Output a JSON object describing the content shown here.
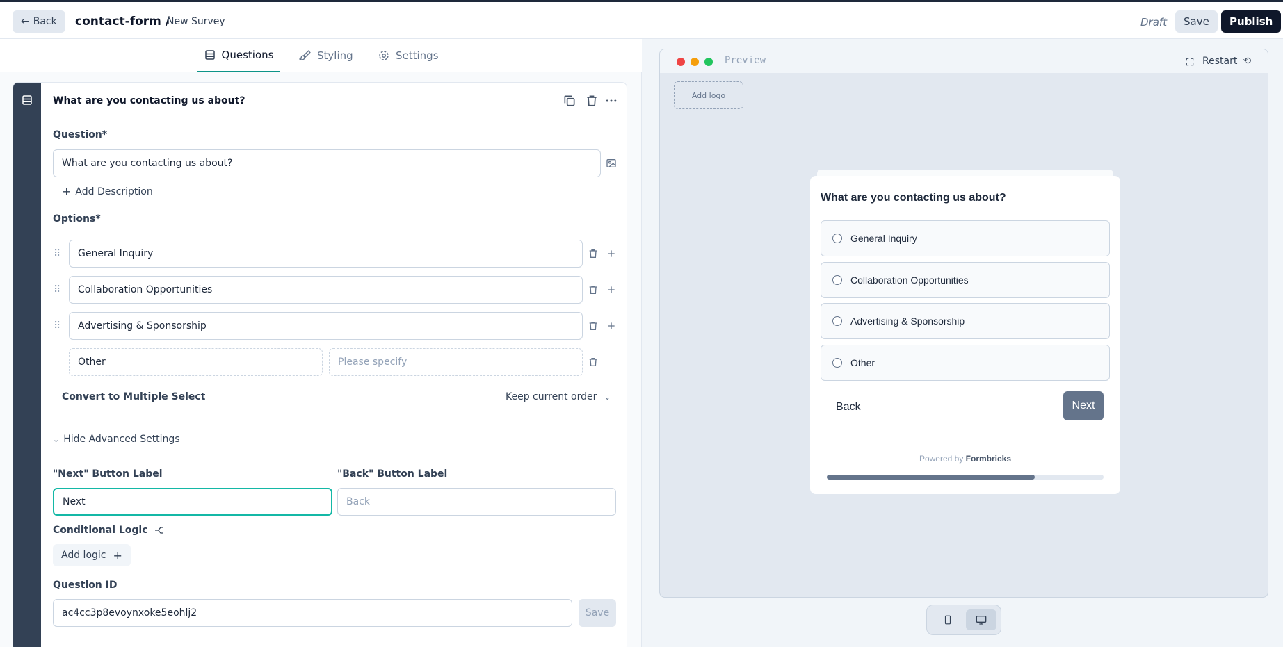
{
  "header": {
    "back_label": "Back",
    "survey_path": "contact-form /",
    "survey_name": "New Survey",
    "status": "Draft",
    "save_label": "Save",
    "publish_label": "Publish"
  },
  "tabs": [
    {
      "label": "Questions",
      "icon": "rows-icon",
      "active": true
    },
    {
      "label": "Styling",
      "icon": "paintbrush-icon",
      "active": false
    },
    {
      "label": "Settings",
      "icon": "gear-icon",
      "active": false
    }
  ],
  "editor": {
    "card_title": "What are you contacting us about?",
    "question_label": "Question*",
    "question_value": "What are you contacting us about?",
    "add_description": "Add Description",
    "options_label": "Options*",
    "options": [
      "General Inquiry",
      "Collaboration Opportunities",
      "Advertising & Sponsorship"
    ],
    "other_option": "Other",
    "other_placeholder": "Please specify",
    "convert_label": "Convert to Multiple Select",
    "order_label": "Keep current order",
    "advanced_toggle": "Hide Advanced Settings",
    "next_label_title": "\"Next\" Button Label",
    "next_label_value": "Next",
    "back_label_title": "\"Back\" Button Label",
    "back_label_placeholder": "Back",
    "logic_label": "Conditional Logic",
    "add_logic": "Add logic",
    "question_id_label": "Question ID",
    "question_id_value": "ac4cc3p8evoynxoke5eohlj2",
    "save_id_label": "Save"
  },
  "preview": {
    "label": "Preview",
    "restart_label": "Restart",
    "add_logo": "Add logo",
    "title": "What are you contacting us about?",
    "options": [
      "General Inquiry",
      "Collaboration Opportunities",
      "Advertising & Sponsorship",
      "Other"
    ],
    "back_button": "Back",
    "next_button": "Next",
    "powered_by_prefix": "Powered by",
    "powered_by_brand": "Formbricks",
    "progress": 0.75
  },
  "colors": {
    "accent": "#0d9488",
    "publish_bg": "#0f172a",
    "rail": "#334155",
    "next_button_bg": "#64748b"
  }
}
